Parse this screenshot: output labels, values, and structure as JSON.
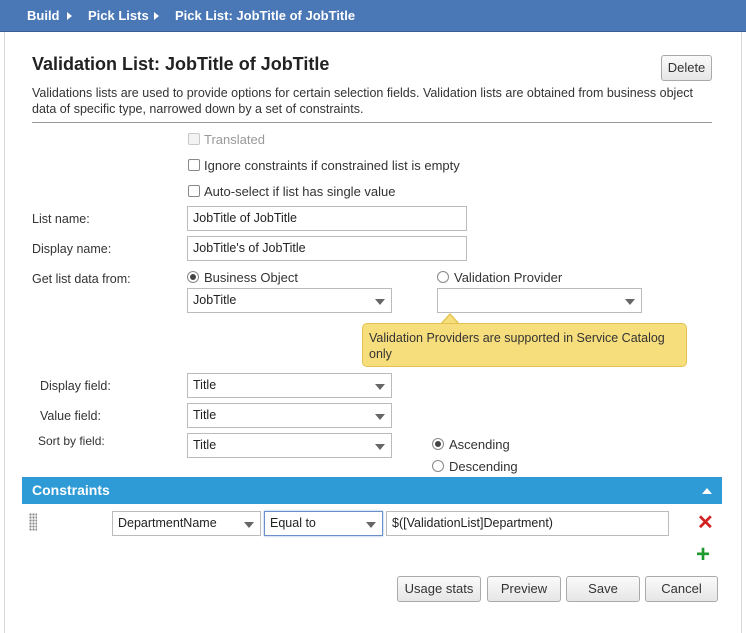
{
  "breadcrumb": {
    "items": [
      "Build",
      "Pick Lists",
      "Pick List: JobTitle of JobTitle"
    ]
  },
  "header": {
    "title": "Validation List: JobTitle of JobTitle",
    "delete_label": "Delete",
    "description": "Validations lists are used to provide options for certain selection fields. Validation lists are obtained from business object data of specific type, narrowed down by a set of constraints."
  },
  "options": {
    "translated": {
      "label": "Translated",
      "checked": false,
      "disabled": true
    },
    "ignore_constraints": {
      "label": "Ignore constraints if constrained list is empty",
      "checked": false
    },
    "auto_select": {
      "label": "Auto-select if list has single value",
      "checked": false
    }
  },
  "form": {
    "list_name": {
      "label": "List name:",
      "value": "JobTitle of JobTitle"
    },
    "display_name": {
      "label": "Display name:",
      "value": "JobTitle's of JobTitle"
    },
    "source": {
      "label": "Get list data from:",
      "business_object": {
        "label": "Business Object",
        "selected": true,
        "value": "JobTitle"
      },
      "validation_provider": {
        "label": "Validation Provider",
        "selected": false,
        "value": ""
      }
    },
    "tooltip": "Validation Providers are supported in Service Catalog only",
    "display_field": {
      "label": "Display field:",
      "value": "Title"
    },
    "value_field": {
      "label": "Value field:",
      "value": "Title"
    },
    "sort_by_field": {
      "label": "Sort by field:",
      "value": "Title"
    },
    "sort_order": {
      "ascending": "Ascending",
      "descending": "Descending",
      "selected": "ascending"
    }
  },
  "constraints": {
    "title": "Constraints",
    "rows": [
      {
        "field": "DepartmentName",
        "operator": "Equal to",
        "value": "$([ValidationList]Department)"
      }
    ]
  },
  "footer": {
    "usage_stats": "Usage stats",
    "preview": "Preview",
    "save": "Save",
    "cancel": "Cancel"
  },
  "colors": {
    "topbar": "#4a77b6",
    "section_bar": "#2e9bd6",
    "tooltip_bg": "#f7de7d",
    "delete_icon": "#d32020",
    "add_icon": "#1e9a2e"
  }
}
